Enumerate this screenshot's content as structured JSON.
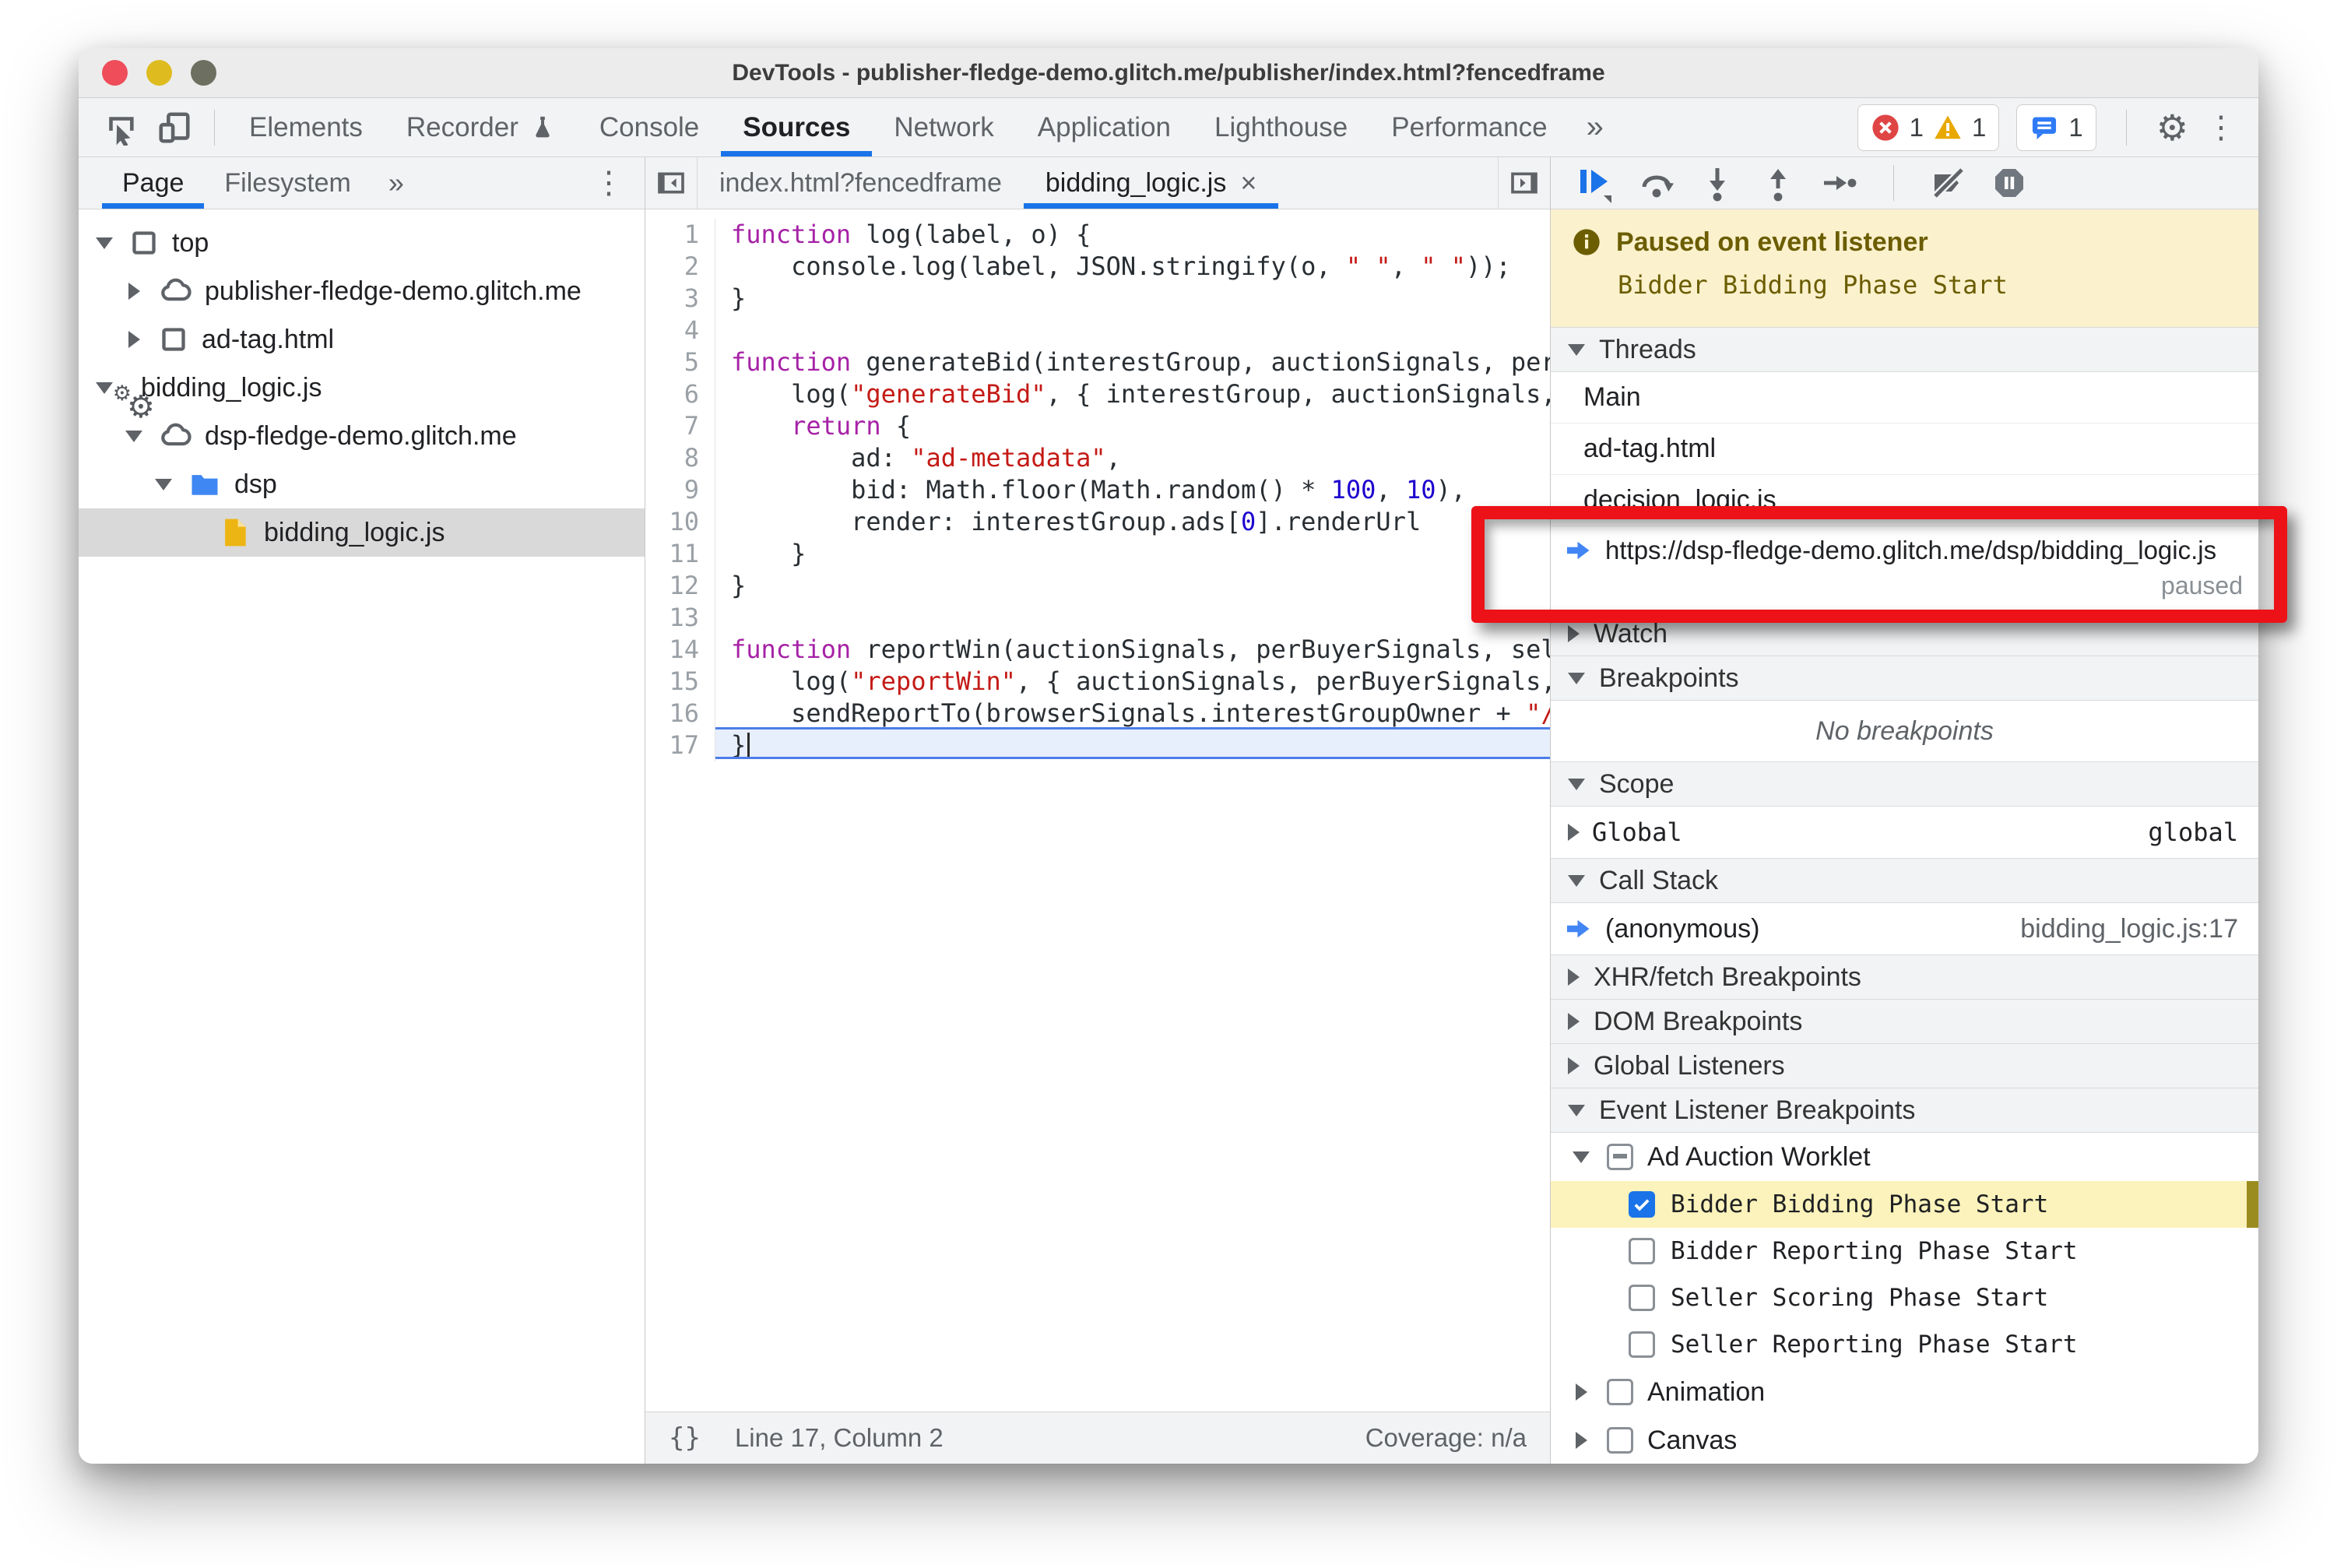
{
  "window": {
    "title": "DevTools - publisher-fledge-demo.glitch.me/publisher/index.html?fencedframe"
  },
  "toolbar": {
    "icons": [
      "inspect-icon",
      "device-toolbar-icon"
    ],
    "tabs": [
      {
        "label": "Elements"
      },
      {
        "label": "Recorder",
        "icon": "flask-icon"
      },
      {
        "label": "Console"
      },
      {
        "label": "Sources",
        "active": true
      },
      {
        "label": "Network"
      },
      {
        "label": "Application"
      },
      {
        "label": "Lighthouse"
      },
      {
        "label": "Performance"
      }
    ],
    "more_tabs": "»",
    "badges": {
      "errors": "1",
      "warnings": "1",
      "issues": "1"
    }
  },
  "sidebar": {
    "tabs": [
      {
        "label": "Page",
        "active": true
      },
      {
        "label": "Filesystem"
      }
    ],
    "more_tabs": "»",
    "tree": [
      {
        "label": "top",
        "icon": "frame-icon",
        "depth": 0,
        "arrow": "down"
      },
      {
        "label": "publisher-fledge-demo.glitch.me",
        "icon": "cloud-icon",
        "depth": 1,
        "arrow": "right"
      },
      {
        "label": "ad-tag.html",
        "icon": "frame-icon",
        "depth": 1,
        "arrow": "right"
      },
      {
        "label": "bidding_logic.js",
        "icon": "worker-icon",
        "depth": 0,
        "arrow": "down"
      },
      {
        "label": "dsp-fledge-demo.glitch.me",
        "icon": "cloud-icon",
        "depth": 1,
        "arrow": "down"
      },
      {
        "label": "dsp",
        "icon": "folder-icon",
        "depth": 2,
        "arrow": "down"
      },
      {
        "label": "bidding_logic.js",
        "icon": "file-icon",
        "depth": 3,
        "arrow": "none",
        "selected": true
      }
    ]
  },
  "editor": {
    "tabs": [
      {
        "label": "index.html?fencedframe"
      },
      {
        "label": "bidding_logic.js",
        "active": true,
        "close": "×"
      }
    ],
    "current_line": 17,
    "lines": [
      {
        "n": 1,
        "segs": [
          [
            "function",
            "kw"
          ],
          [
            " log(label, o) {",
            "pl"
          ]
        ]
      },
      {
        "n": 2,
        "segs": [
          [
            "    console.log(label, JSON.stringify(o, ",
            "pl"
          ],
          [
            "\" \"",
            "str"
          ],
          [
            ", ",
            "pl"
          ],
          [
            "\" \"",
            "str"
          ],
          [
            "));",
            "pl"
          ]
        ]
      },
      {
        "n": 3,
        "segs": [
          [
            "}",
            "pl"
          ]
        ]
      },
      {
        "n": 4,
        "segs": []
      },
      {
        "n": 5,
        "segs": [
          [
            "function",
            "kw"
          ],
          [
            " generateBid(interestGroup, auctionSignals, perBuyerSignals, trustedBiddingSignals, browserSignals) {",
            "pl"
          ]
        ]
      },
      {
        "n": 6,
        "segs": [
          [
            "    log(",
            "pl"
          ],
          [
            "\"generateBid\"",
            "str"
          ],
          [
            ", { interestGroup, auctionSignals, perBuyerSignals, trustedBiddingSignals, browserSignals });",
            "pl"
          ]
        ]
      },
      {
        "n": 7,
        "segs": [
          [
            "    ",
            "pl"
          ],
          [
            "return",
            "kw"
          ],
          [
            " {",
            "pl"
          ]
        ]
      },
      {
        "n": 8,
        "segs": [
          [
            "        ad: ",
            "pl"
          ],
          [
            "\"ad-metadata\"",
            "str"
          ],
          [
            ",",
            "pl"
          ]
        ]
      },
      {
        "n": 9,
        "segs": [
          [
            "        bid: Math.floor(Math.random() * ",
            "pl"
          ],
          [
            "100",
            "num"
          ],
          [
            ", ",
            "pl"
          ],
          [
            "10",
            "num"
          ],
          [
            "),",
            "pl"
          ]
        ]
      },
      {
        "n": 10,
        "segs": [
          [
            "        render: interestGroup.ads[",
            "pl"
          ],
          [
            "0",
            "num"
          ],
          [
            "].renderUrl",
            "pl"
          ]
        ]
      },
      {
        "n": 11,
        "segs": [
          [
            "    }",
            "pl"
          ]
        ]
      },
      {
        "n": 12,
        "segs": [
          [
            "}",
            "pl"
          ]
        ]
      },
      {
        "n": 13,
        "segs": []
      },
      {
        "n": 14,
        "segs": [
          [
            "function",
            "kw"
          ],
          [
            " reportWin(auctionSignals, perBuyerSignals, sellerSignals, browserSignals) {",
            "pl"
          ]
        ]
      },
      {
        "n": 15,
        "segs": [
          [
            "    log(",
            "pl"
          ],
          [
            "\"reportWin\"",
            "str"
          ],
          [
            ", { auctionSignals, perBuyerSignals, sellerSignals, browserSignals });",
            "pl"
          ]
        ]
      },
      {
        "n": 16,
        "segs": [
          [
            "    sendReportTo(browserSignals.interestGroupOwner + ",
            "pl"
          ],
          [
            "\"/reporting?report=win\"",
            "str"
          ],
          [
            ");",
            "pl"
          ]
        ]
      },
      {
        "n": 17,
        "segs": [
          [
            "}",
            "pl"
          ]
        ],
        "cursor": true
      }
    ],
    "status": {
      "pretty_print": "{}",
      "position": "Line 17, Column 2",
      "coverage": "Coverage: n/a"
    }
  },
  "debugger": {
    "toolbar": [
      "resume-icon",
      "step-over-icon",
      "step-into-icon",
      "step-out-icon",
      "step-icon",
      "divider",
      "deactivate-breakpoints-icon",
      "pause-on-exceptions-icon"
    ],
    "paused": {
      "title": "Paused on event listener",
      "detail": "Bidder Bidding Phase Start"
    },
    "threads": {
      "title": "Threads",
      "items": [
        {
          "label": "Main"
        },
        {
          "label": "ad-tag.html"
        },
        {
          "label": "decision_logic.js"
        },
        {
          "label": "https://dsp-fledge-demo.glitch.me/dsp/bidding_logic.js",
          "status": "paused",
          "current": true,
          "annotated": true
        }
      ]
    },
    "watch": {
      "title": "Watch"
    },
    "breakpoints": {
      "title": "Breakpoints",
      "empty": "No breakpoints"
    },
    "scope": {
      "title": "Scope",
      "items": [
        {
          "name": "Global",
          "value": "global"
        }
      ]
    },
    "call_stack": {
      "title": "Call Stack",
      "items": [
        {
          "name": "(anonymous)",
          "location": "bidding_logic.js:17",
          "current": true
        }
      ]
    },
    "collapsed_sections": [
      {
        "title": "XHR/fetch Breakpoints"
      },
      {
        "title": "DOM Breakpoints"
      },
      {
        "title": "Global Listeners"
      }
    ],
    "event_listener_breakpoints": {
      "title": "Event Listener Breakpoints",
      "groups": [
        {
          "label": "Ad Auction Worklet",
          "checkbox": "indeterminate",
          "arrow": "down",
          "children": [
            {
              "label": "Bidder Bidding Phase Start",
              "checked": true,
              "highlighted": true
            },
            {
              "label": "Bidder Reporting Phase Start",
              "checked": false
            },
            {
              "label": "Seller Scoring Phase Start",
              "checked": false
            },
            {
              "label": "Seller Reporting Phase Start",
              "checked": false
            }
          ]
        },
        {
          "label": "Animation",
          "checkbox": "unchecked",
          "arrow": "right",
          "children": []
        },
        {
          "label": "Canvas",
          "checkbox": "unchecked",
          "arrow": "right",
          "children": []
        }
      ]
    }
  },
  "colors": {
    "accent": "#1a73e8",
    "annotation": "#ec1218",
    "paused_banner": "#fbf1cd",
    "highlight_row": "#fbf3bb"
  }
}
